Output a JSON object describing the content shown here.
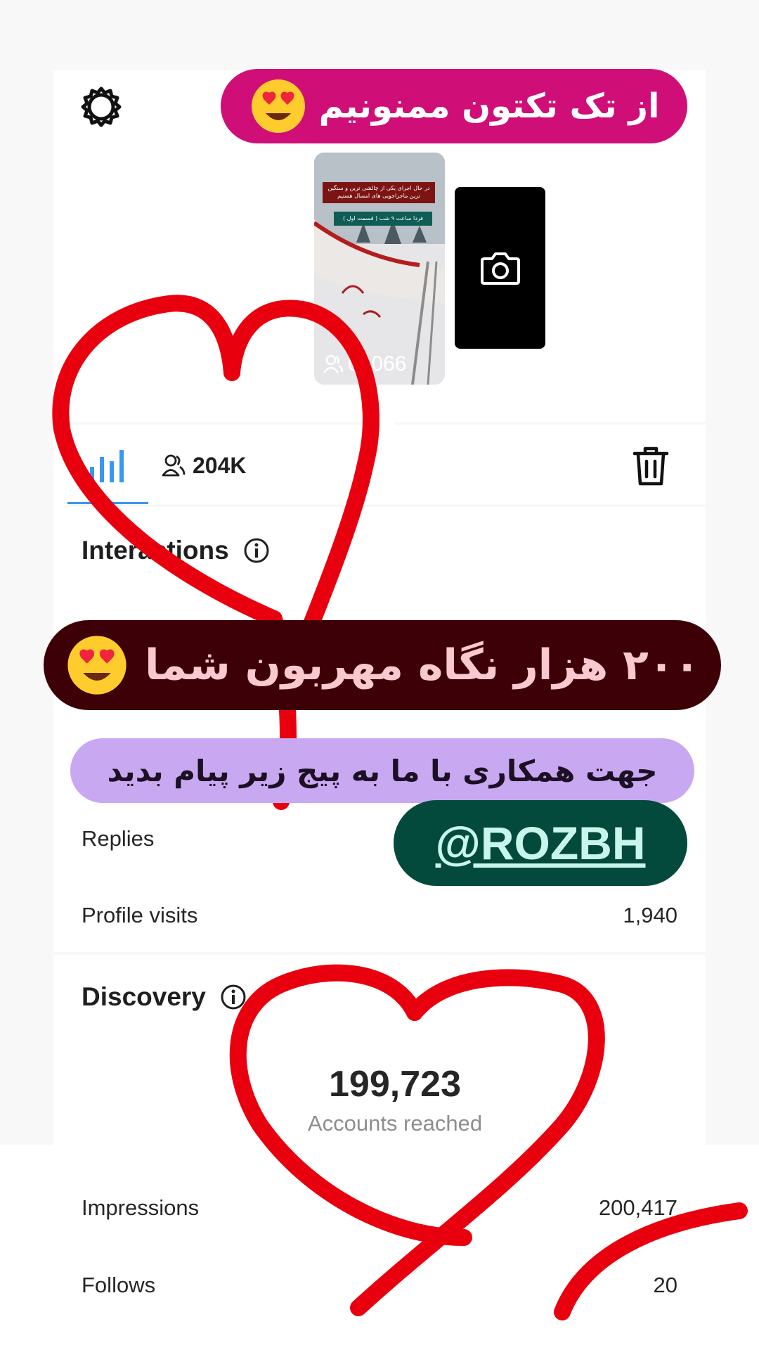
{
  "story": {
    "views_count": "04066",
    "caption_line1": "در حال اجرای یکی از چالشی ترین و سنگین ترین ماجراجویی های امسال هستیم",
    "caption_line2": "فردا ساعت ۹ شب ( قسمت اول )"
  },
  "tabs": {
    "followers_count": "204K"
  },
  "interactions": {
    "title": "Interactions",
    "rows": [
      {
        "label": "Replies",
        "value": ""
      },
      {
        "label": "Profile visits",
        "value": "1,940"
      }
    ]
  },
  "discovery": {
    "title": "Discovery",
    "accounts_reached_value": "199,723",
    "accounts_reached_label": "Accounts reached",
    "rows": [
      {
        "label": "Impressions",
        "value": "200,417"
      },
      {
        "label": "Follows",
        "value": "20"
      }
    ]
  },
  "stickers": {
    "top_text": "از تک تکتون ممنونیم",
    "middle_text": "۲۰۰ هزار نگاه مهربون شما",
    "purple_text": "جهت همکاری با ما به پیج زیر پیام بدید",
    "mention": "@ROZBH"
  },
  "colors": {
    "top_pill": "#cf0f77",
    "middle_pill": "#3d0006",
    "purple_pill": "#c9a8f2",
    "mention_pill": "#034a3c",
    "hearts": "#e8000e",
    "tab_accent": "#3897f0"
  }
}
